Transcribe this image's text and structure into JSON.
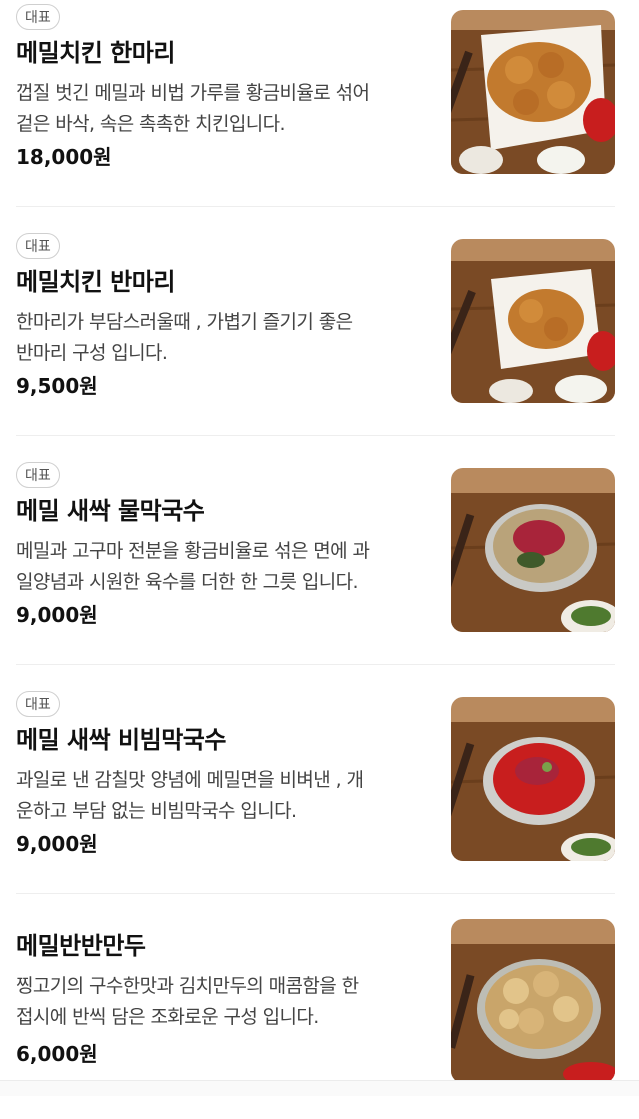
{
  "menu": {
    "items": [
      {
        "badge": "대표",
        "name": "메밀치킨 한마리",
        "desc_line1": "껍질 벗긴 메밀과 비법 가루를 황금비율로 섞어",
        "desc_line2": "겉은 바삭, 속은 촉촉한 치킨입니다.",
        "price": "18,000원",
        "image_icon": "fried-chicken-plate"
      },
      {
        "badge": "대표",
        "name": "메밀치킨 반마리",
        "desc_line1": "한마리가 부담스러울때 , 가볍기 즐기기 좋은",
        "desc_line2": "반마리 구성 입니다.",
        "price": "9,500원",
        "image_icon": "fried-chicken-half-plate"
      },
      {
        "badge": "대표",
        "name": "메밀 새싹 물막국수",
        "desc_line1": "메밀과 고구마 전분을 황금비율로 섞은 면에 과",
        "desc_line2": "일양념과 시원한 육수를 더한 한 그릇 입니다.",
        "price": "9,000원",
        "image_icon": "cold-noodle-bowl"
      },
      {
        "badge": "대표",
        "name": "메밀 새싹 비빔막국수",
        "desc_line1": "과일로 낸 감칠맛 양념에 메밀면을 비벼낸 , 개",
        "desc_line2": "운하고 부담 없는 비빔막국수 입니다.",
        "price": "9,000원",
        "image_icon": "spicy-noodle-bowl"
      },
      {
        "badge": "",
        "name": "메밀반반만두",
        "desc_line1": "찡고기의 구수한맛과 김치만두의 매콤함을 한",
        "desc_line2": "접시에 반씩 담은 조화로운 구성 입니다.",
        "price": "6,000원",
        "image_icon": "dumpling-pot"
      }
    ]
  },
  "colors": {
    "wood": "#7a4a25",
    "chicken": "#c27a2e",
    "sauce": "#c81e1e"
  }
}
